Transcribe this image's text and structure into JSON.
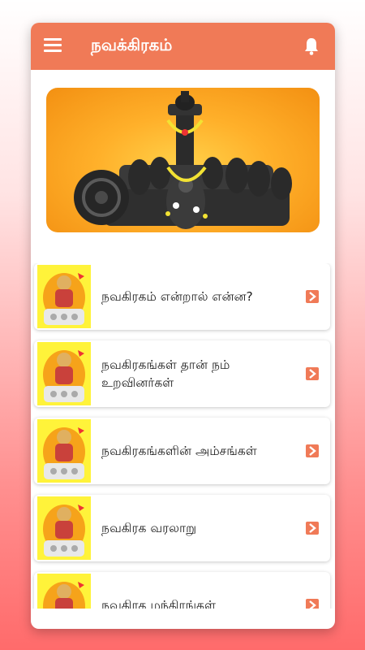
{
  "appbar": {
    "title": "நவக்கிரகம்",
    "menu_icon": "hamburger-menu-icon",
    "bell_icon": "bell-icon",
    "color": "#f07a57"
  },
  "banner": {
    "image": "navagraha-idols-photo"
  },
  "items": [
    {
      "label": "நவகிரகம் என்றால் என்ன?"
    },
    {
      "label": "நவகிரகங்கள் தான் நம் உறவினர்கள்"
    },
    {
      "label": "நவகிரகங்களின் அம்சங்கள்"
    },
    {
      "label": "நவகிரக வரலாறு"
    },
    {
      "label": "நவகிரக மந்திரங்கள்"
    }
  ],
  "colors": {
    "accent": "#f07a57",
    "thumb_bg": "#fff33a"
  }
}
